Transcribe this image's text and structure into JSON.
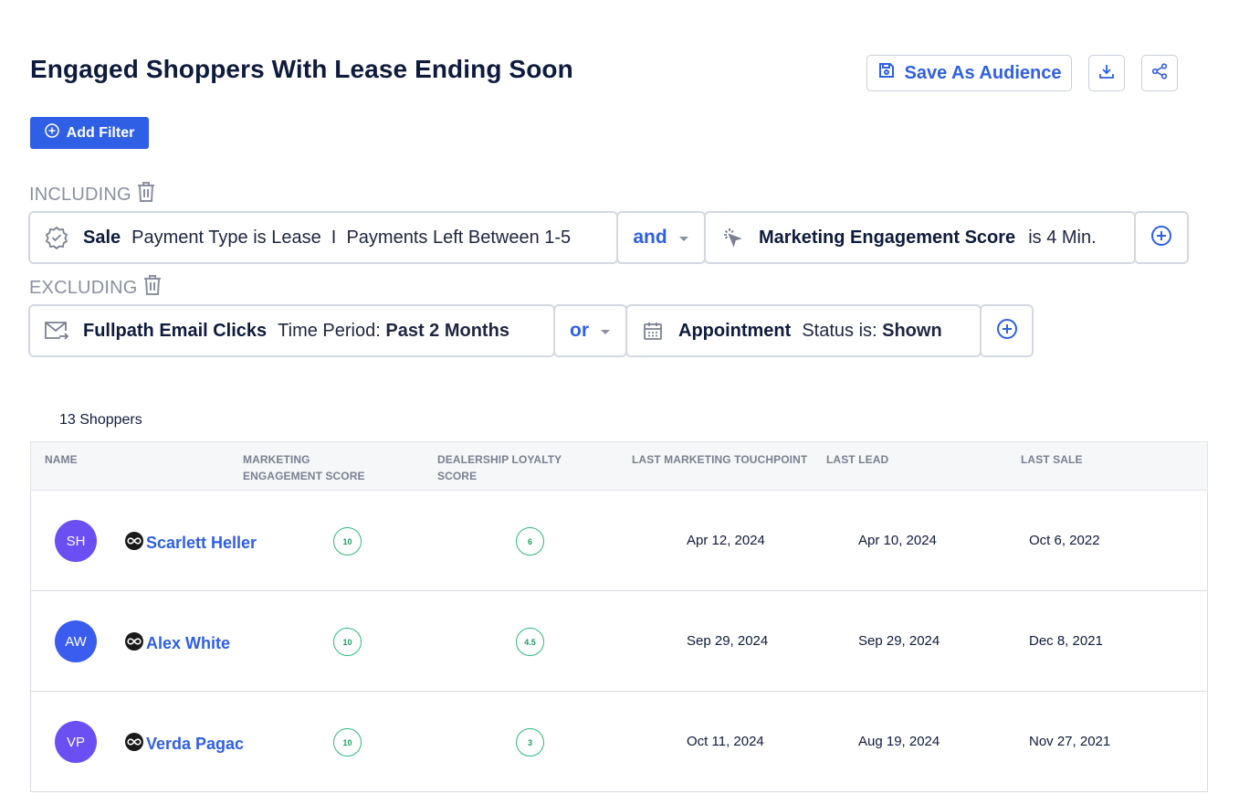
{
  "header": {
    "title": "Engaged Shoppers With Lease Ending Soon",
    "save_label": "Save As Audience"
  },
  "add_filter_label": "Add Filter",
  "including": {
    "label": "INCLUDING",
    "filter1": {
      "name": "Sale",
      "desc": "Payment Type is Lease  I  Payments Left Between 1-5"
    },
    "operator": "and",
    "filter2": {
      "name": "Marketing Engagement Score",
      "desc": "is 4 Min."
    }
  },
  "excluding": {
    "label": "EXCLUDING",
    "filter1": {
      "name": "Fullpath Email Clicks",
      "desc_prefix": "Time Period: ",
      "desc_value": "Past 2 Months"
    },
    "operator": "or",
    "filter2": {
      "name": "Appointment",
      "desc_prefix": "Status is: ",
      "desc_value": "Shown"
    }
  },
  "shopper_count": "13 Shoppers",
  "table": {
    "headers": {
      "name": "NAME",
      "mes_line1": "MARKETING",
      "mes_line2": "ENGAGEMENT SCORE",
      "dls_line1": "DEALERSHIP LOYALTY",
      "dls_line2": "SCORE",
      "touchpoint": "LAST MARKETING TOUCHPOINT",
      "lead": "LAST LEAD",
      "sale": "LAST SALE"
    },
    "rows": [
      {
        "initials": "SH",
        "avatar_color": "#6b4ff2",
        "name": "Scarlett Heller",
        "mes": "10",
        "dls": "6",
        "touchpoint": "Apr 12, 2024",
        "lead": "Apr 10, 2024",
        "sale": "Oct 6, 2022"
      },
      {
        "initials": "AW",
        "avatar_color": "#3a5df0",
        "name": "Alex White",
        "mes": "10",
        "dls": "4.5",
        "touchpoint": "Sep 29, 2024",
        "lead": "Sep 29, 2024",
        "sale": "Dec 8, 2021"
      },
      {
        "initials": "VP",
        "avatar_color": "#6b4ff2",
        "name": "Verda Pagac",
        "mes": "10",
        "dls": "3",
        "touchpoint": "Oct 11, 2024",
        "lead": "Aug 19, 2024",
        "sale": "Nov 27, 2021"
      }
    ]
  }
}
